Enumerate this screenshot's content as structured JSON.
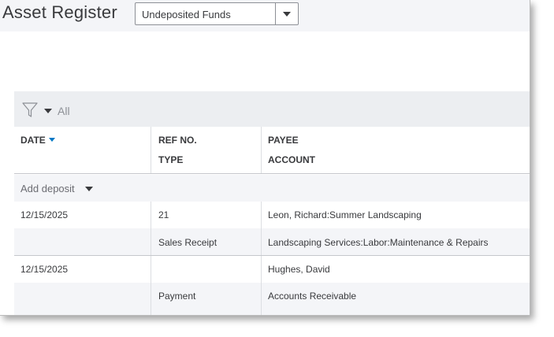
{
  "header": {
    "title": "Asset Register",
    "account_select_value": "Undeposited Funds"
  },
  "filter": {
    "label": "All",
    "icon": "funnel-icon"
  },
  "columns": {
    "date": "DATE",
    "ref_no": "REF NO.",
    "type": "TYPE",
    "payee": "PAYEE",
    "account": "ACCOUNT"
  },
  "add_deposit_label": "Add deposit",
  "rows": [
    {
      "date": "12/15/2025",
      "ref_no": "21",
      "type": "Sales Receipt",
      "payee": "Leon, Richard:Summer Landscaping",
      "account": "Landscaping Services:Labor:Maintenance & Repairs"
    },
    {
      "date": "12/15/2025",
      "ref_no": "",
      "type": "Payment",
      "payee": "Hughes, David",
      "account": "Accounts Receivable"
    }
  ]
}
